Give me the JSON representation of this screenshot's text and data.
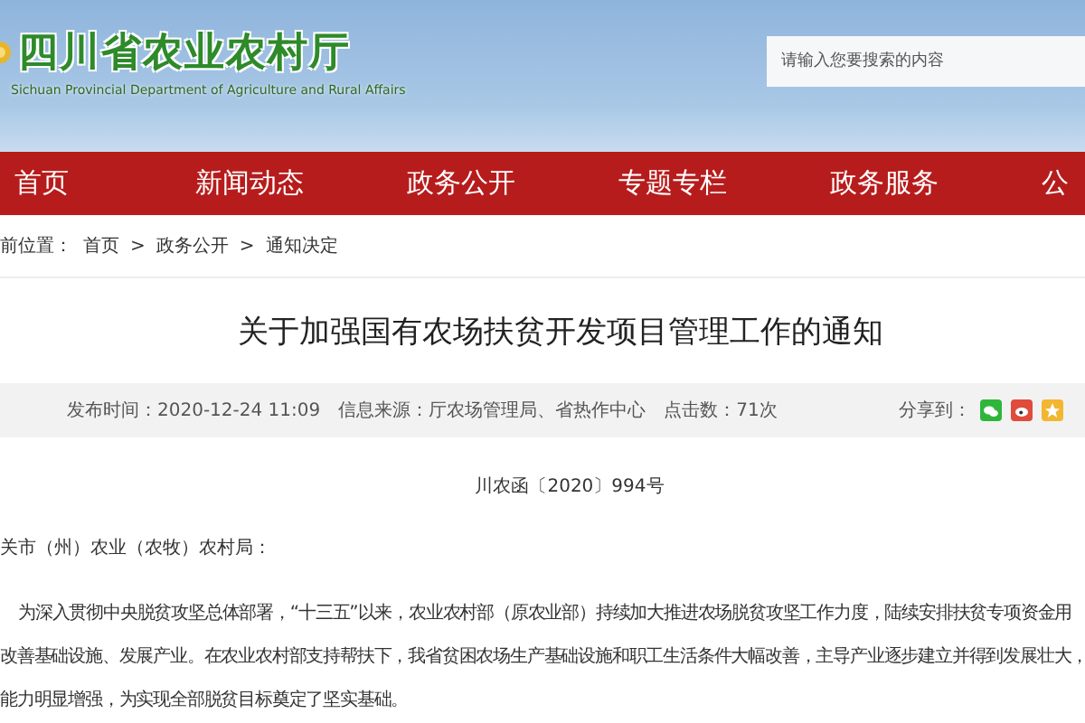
{
  "header": {
    "title": "四川省农业农村厅",
    "subtitle": "Sichuan Provincial Department of Agriculture and Rural Affairs",
    "search": {
      "placeholder": "请输入您要搜索的内容"
    }
  },
  "nav": [
    {
      "label": "首页",
      "selected": false
    },
    {
      "label": "新闻动态",
      "selected": false
    },
    {
      "label": "政务公开",
      "selected": false
    },
    {
      "label": "专题专栏",
      "selected": false
    },
    {
      "label": "政务服务",
      "selected": false
    },
    {
      "label": "公",
      "selected": false
    }
  ],
  "breadcrumb": {
    "prefix": "前位置：",
    "items": [
      "首页",
      "政务公开",
      "通知决定"
    ],
    "separator": ">"
  },
  "article": {
    "title": "关于加强国有农场扶贫开发项目管理工作的通知",
    "meta": [
      "发布时间：2020-12-24 11:09",
      "信息来源：厅农场管理局、省热作中心",
      "点击数：71次"
    ],
    "share": {
      "label": "分享到：",
      "icons": [
        {
          "kind": "wechat",
          "color": "#2fb63a"
        },
        {
          "kind": "weibo",
          "color": "#e04b3c"
        },
        {
          "kind": "qzone",
          "color": "#f2b630"
        }
      ]
    },
    "doc_number": "川农函〔2020〕994号",
    "salutation": "关市（州）农业（农牧）农村局：",
    "lines": [
      "为深入贯彻中央脱贫攻坚总体部署，“十三五”以来，农业农村部（原农业部）持续加大推进农场脱贫攻坚工作力度，陆续安排扶贫专项资金用",
      "改善基础设施、发展产业。在农业农村部支持帮扶下，我省贫困农场生产基础设施和职工生活条件大幅改善，主导产业逐步建立并得到发展壮大，",
      "能力明显增强，为实现全部脱贫目标奠定了坚实基础。"
    ]
  }
}
